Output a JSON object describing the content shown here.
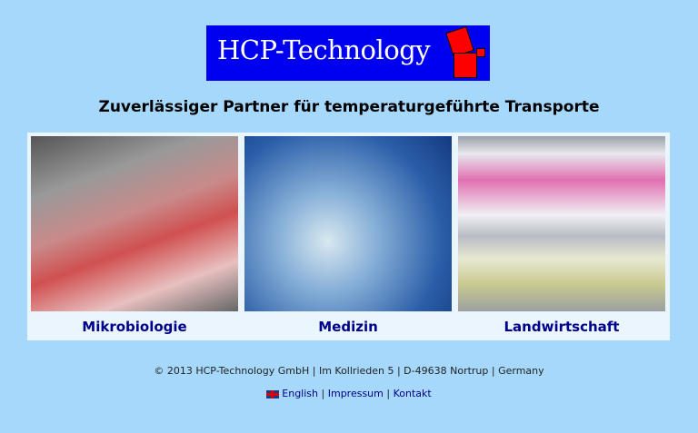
{
  "logo": {
    "text": "HCP-Technology"
  },
  "tagline": "Zuverlässiger Partner für temperaturgeführte Transporte",
  "categories": [
    {
      "label": "Mikrobiologie"
    },
    {
      "label": "Medizin"
    },
    {
      "label": "Landwirtschaft"
    }
  ],
  "footer": {
    "address": "© 2013 HCP-Technology GmbH | Im Kollrieden 5 | D-49638 Nortrup | Germany"
  },
  "links": {
    "english": "English",
    "sep": "|",
    "impressum": "Impressum",
    "kontakt": "Kontakt"
  },
  "colors": {
    "background": "#a6d8fb",
    "logo_bg": "#0000f0",
    "link": "#00008b"
  }
}
